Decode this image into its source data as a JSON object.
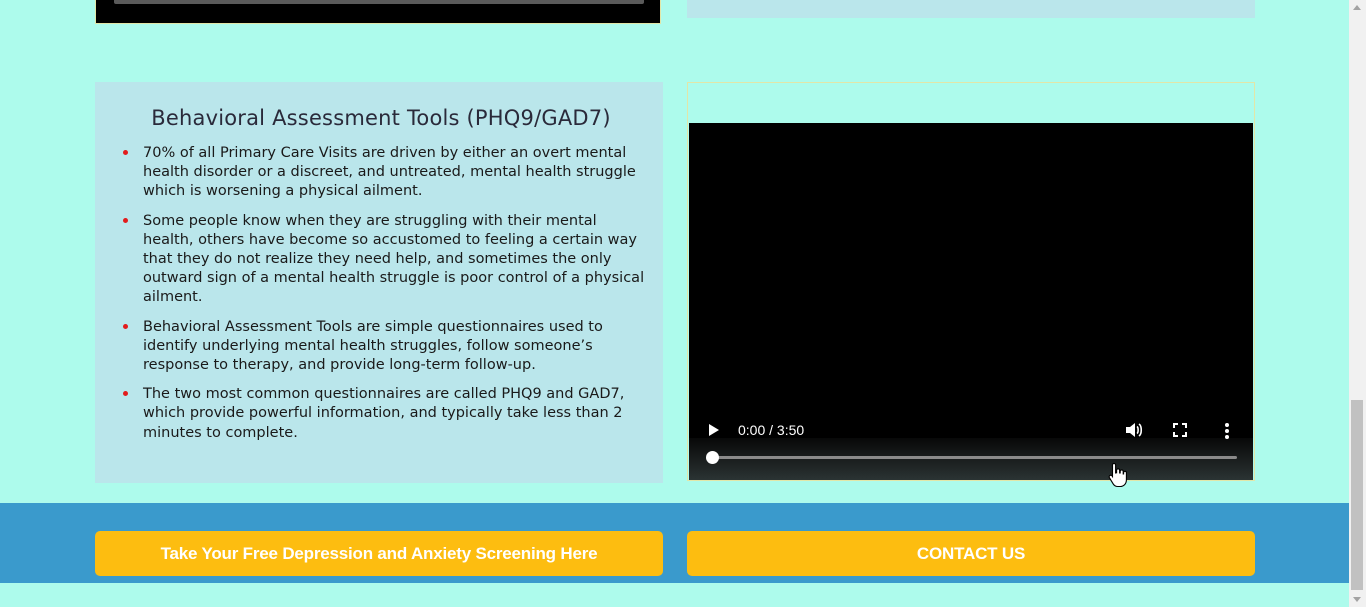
{
  "card": {
    "title": "Behavioral Assessment Tools (PHQ9/GAD7)",
    "bullets": [
      "70% of all Primary Care Visits are driven by either an overt mental health disorder or a discreet, and untreated, mental health struggle which is worsening a physical ailment.",
      "Some people know when they are struggling with their mental health, others have become so accustomed to feeling a certain way that they do not realize they need help, and sometimes the only outward sign of a mental health struggle is poor control of a physical ailment.",
      "Behavioral Assessment Tools are simple questionnaires used to identify underlying mental health struggles, follow someone’s response to therapy, and provide long-term follow-up.",
      "The two most common questionnaires are called PHQ9 and GAD7, which provide powerful information, and typically take less than 2 minutes to complete."
    ]
  },
  "video": {
    "time": "0:00 / 3:50",
    "progress_fraction": 0
  },
  "buttons": {
    "screening": "Take Your Free Depression and Anxiety Screening Here",
    "contact": "CONTACT US"
  },
  "colors": {
    "page_bg": "#adfbec",
    "card_bg": "#bae6eb",
    "band_bg": "#3a9acc",
    "button_bg": "#fdbd10",
    "bullet": "#e21c1c"
  }
}
